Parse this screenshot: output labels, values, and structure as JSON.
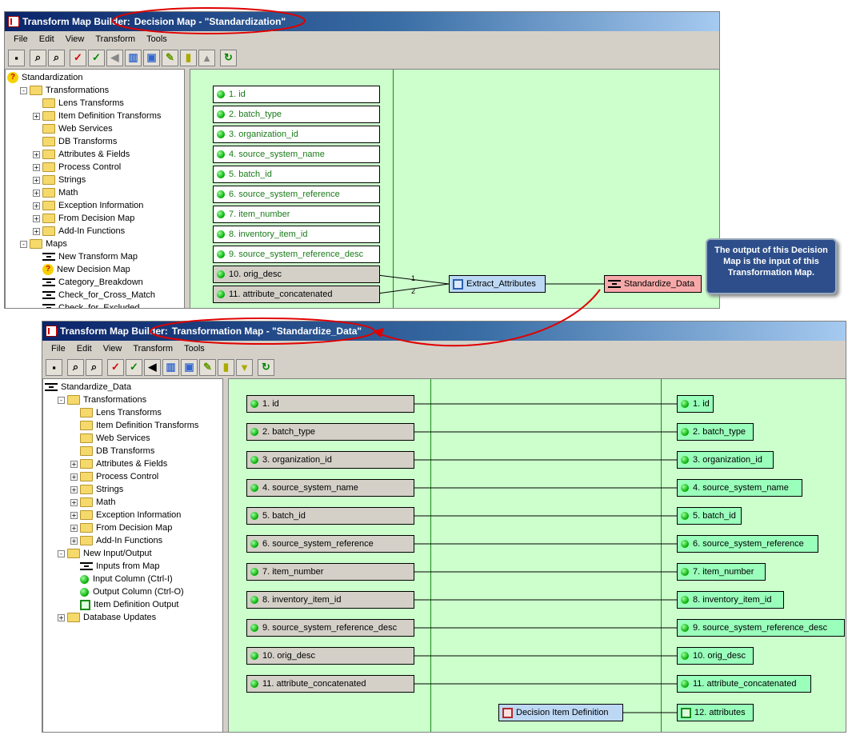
{
  "top_window": {
    "title_app": "Transform Map Builder:",
    "title_doc": "Decision Map - \"Standardization\"",
    "menu": [
      "File",
      "Edit",
      "View",
      "Transform",
      "Tools"
    ],
    "tree": [
      {
        "label": "Standardization",
        "icon": "question-icon",
        "indent": 0,
        "toggle": ""
      },
      {
        "label": "Transformations",
        "icon": "folder-open-icon",
        "indent": 1,
        "toggle": "−"
      },
      {
        "label": "Lens Transforms",
        "icon": "folder-icon",
        "indent": 2,
        "toggle": ""
      },
      {
        "label": "Item Definition Transforms",
        "icon": "folder-icon",
        "indent": 2,
        "toggle": "+"
      },
      {
        "label": "Web Services",
        "icon": "folder-icon",
        "indent": 2,
        "toggle": ""
      },
      {
        "label": "DB Transforms",
        "icon": "folder-icon",
        "indent": 2,
        "toggle": ""
      },
      {
        "label": "Attributes & Fields",
        "icon": "folder-icon",
        "indent": 2,
        "toggle": "+"
      },
      {
        "label": "Process Control",
        "icon": "folder-icon",
        "indent": 2,
        "toggle": "+"
      },
      {
        "label": "Strings",
        "icon": "folder-icon",
        "indent": 2,
        "toggle": "+"
      },
      {
        "label": "Math",
        "icon": "folder-icon",
        "indent": 2,
        "toggle": "+"
      },
      {
        "label": "Exception Information",
        "icon": "folder-icon",
        "indent": 2,
        "toggle": "+"
      },
      {
        "label": "From Decision Map",
        "icon": "folder-icon",
        "indent": 2,
        "toggle": "+"
      },
      {
        "label": "Add-In Functions",
        "icon": "folder-icon",
        "indent": 2,
        "toggle": "+"
      },
      {
        "label": "Maps",
        "icon": "folder-open-icon",
        "indent": 1,
        "toggle": "−"
      },
      {
        "label": "New Transform Map",
        "icon": "map-icon",
        "indent": 2,
        "toggle": ""
      },
      {
        "label": "New Decision Map",
        "icon": "question-icon",
        "indent": 2,
        "toggle": ""
      },
      {
        "label": "Category_Breakdown",
        "icon": "map-icon",
        "indent": 2,
        "toggle": ""
      },
      {
        "label": "Check_for_Cross_Match",
        "icon": "map-icon",
        "indent": 2,
        "toggle": ""
      },
      {
        "label": "Check_for_Excluded",
        "icon": "map-icon",
        "indent": 2,
        "toggle": ""
      }
    ],
    "fields": [
      "1. id",
      "2. batch_type",
      "3. organization_id",
      "4. source_system_name",
      "5. batch_id",
      "6. source_system_reference",
      "7. item_number",
      "8. inventory_item_id",
      "9. source_system_reference_desc",
      "10. orig_desc",
      "11. attribute_concatenated"
    ],
    "nodes": {
      "extract": "Extract_Attributes",
      "standardize": "Standardize_Data"
    },
    "link_labels": [
      "1",
      "2"
    ]
  },
  "callout": "The output of this Decision Map is the input of this Transformation Map.",
  "bottom_window": {
    "title_app": "Transform Map Builder:",
    "title_doc": "Transformation Map - \"Standardize_Data\"",
    "menu": [
      "File",
      "Edit",
      "View",
      "Transform",
      "Tools"
    ],
    "tree": [
      {
        "label": "Standardize_Data",
        "icon": "map-icon",
        "indent": 0,
        "toggle": ""
      },
      {
        "label": "Transformations",
        "icon": "folder-open-icon",
        "indent": 1,
        "toggle": "−"
      },
      {
        "label": "Lens Transforms",
        "icon": "folder-icon",
        "indent": 2,
        "toggle": ""
      },
      {
        "label": "Item Definition Transforms",
        "icon": "folder-icon",
        "indent": 2,
        "toggle": ""
      },
      {
        "label": "Web Services",
        "icon": "folder-icon",
        "indent": 2,
        "toggle": ""
      },
      {
        "label": "DB Transforms",
        "icon": "folder-icon",
        "indent": 2,
        "toggle": ""
      },
      {
        "label": "Attributes & Fields",
        "icon": "folder-icon",
        "indent": 2,
        "toggle": "+"
      },
      {
        "label": "Process Control",
        "icon": "folder-icon",
        "indent": 2,
        "toggle": "+"
      },
      {
        "label": "Strings",
        "icon": "folder-icon",
        "indent": 2,
        "toggle": "+"
      },
      {
        "label": "Math",
        "icon": "folder-icon",
        "indent": 2,
        "toggle": "+"
      },
      {
        "label": "Exception Information",
        "icon": "folder-icon",
        "indent": 2,
        "toggle": "+"
      },
      {
        "label": "From Decision Map",
        "icon": "folder-icon",
        "indent": 2,
        "toggle": "+"
      },
      {
        "label": "Add-In Functions",
        "icon": "folder-icon",
        "indent": 2,
        "toggle": "+"
      },
      {
        "label": "New Input/Output",
        "icon": "folder-open-icon",
        "indent": 1,
        "toggle": "−"
      },
      {
        "label": "Inputs from Map",
        "icon": "map-icon",
        "indent": 2,
        "toggle": ""
      },
      {
        "label": "Input Column (Ctrl-I)",
        "icon": "dot-icon",
        "indent": 2,
        "toggle": ""
      },
      {
        "label": "Output Column (Ctrl-O)",
        "icon": "dot-icon",
        "indent": 2,
        "toggle": ""
      },
      {
        "label": "Item Definition Output",
        "icon": "itemdef-icon",
        "indent": 2,
        "toggle": ""
      },
      {
        "label": "Database Updates",
        "icon": "folder-icon",
        "indent": 1,
        "toggle": "+"
      }
    ],
    "inputs": [
      "1. id",
      "2. batch_type",
      "3. organization_id",
      "4. source_system_name",
      "5. batch_id",
      "6. source_system_reference",
      "7. item_number",
      "8. inventory_item_id",
      "9. source_system_reference_desc",
      "10. orig_desc",
      "11. attribute_concatenated"
    ],
    "outputs": [
      "1. id",
      "2. batch_type",
      "3. organization_id",
      "4. source_system_name",
      "5. batch_id",
      "6. source_system_reference",
      "7. item_number",
      "8. inventory_item_id",
      "9. source_system_reference_desc",
      "10. orig_desc",
      "11. attribute_concatenated"
    ],
    "decision_node": "Decision Item Definition",
    "attributes_output": "12. attributes"
  },
  "colors": {
    "canvas": "#ccffcc",
    "highlight": "#e00000",
    "callout": "#2d4e8a"
  }
}
